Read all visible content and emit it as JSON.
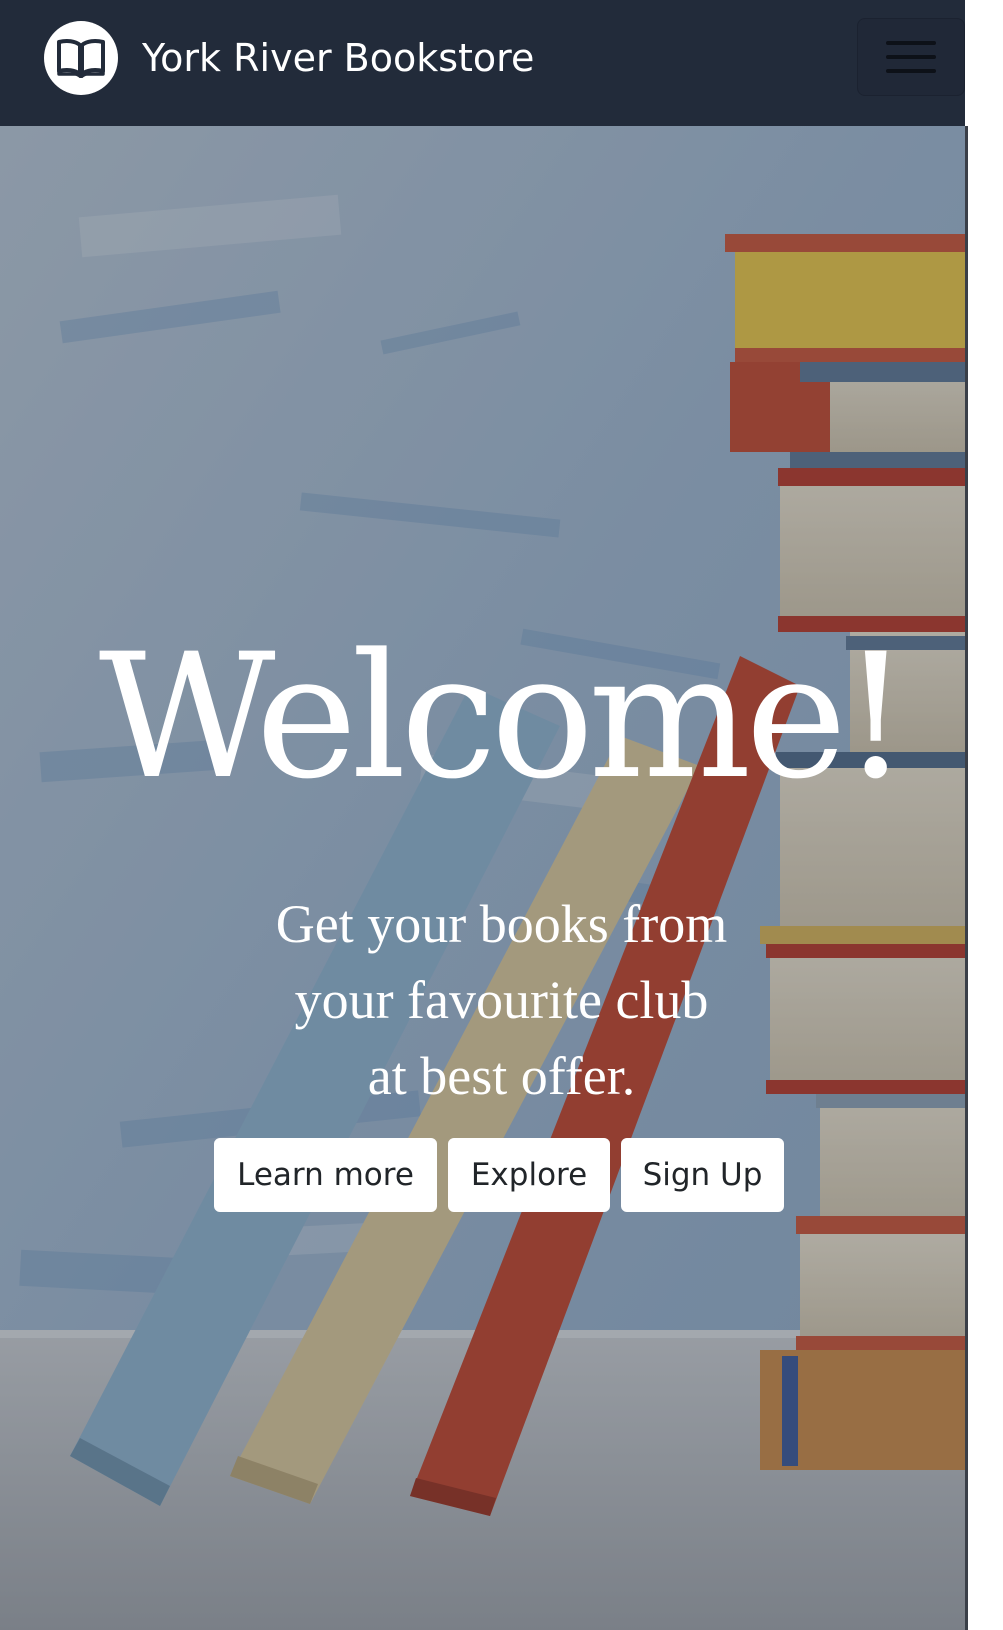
{
  "navbar": {
    "brand_name": "York River Bookstore",
    "logo_icon": "open-book-icon",
    "toggle_icon": "hamburger-menu-icon",
    "background_color": "#222b3a"
  },
  "hero": {
    "heading": "Welcome!",
    "tagline_lines": [
      "Get your books from",
      "your favourite club",
      "at best offer."
    ],
    "buttons": [
      {
        "label": "Learn more"
      },
      {
        "label": "Explore"
      },
      {
        "label": "Sign Up"
      }
    ]
  }
}
